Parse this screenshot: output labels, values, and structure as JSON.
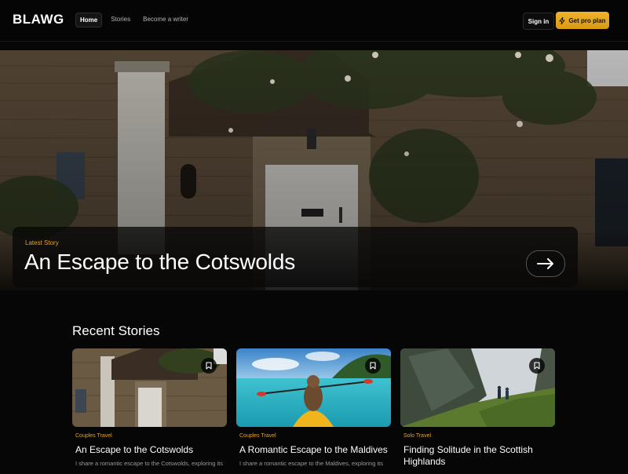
{
  "brand": {
    "logo": "BLAWG",
    "accent": "#f0b32a"
  },
  "nav": {
    "links": [
      "Home",
      "Stories",
      "Become a writer"
    ],
    "active": "Home",
    "signin": "Sign in",
    "pro": "Get pro plan",
    "pro_icon": "lightning-icon"
  },
  "hero": {
    "tag": "Latest Story",
    "title": "An Escape to the Cotswolds",
    "button_icon": "arrow-right-icon"
  },
  "recent": {
    "title": "Recent Stories",
    "cards": [
      {
        "category": "Couples Travel",
        "title": "An Escape to the Cotswolds",
        "excerpt": "I share a romantic escape to the Cotswolds, exploring its",
        "image": "stone-cottage-photo"
      },
      {
        "category": "Couples Travel",
        "title": "A Romantic Escape to the Maldives",
        "excerpt": "I share a romantic escape to the Maldives, exploring its",
        "image": "kayak-lagoon-photo"
      },
      {
        "category": "Solo Travel",
        "title": "Finding Solitude in the Scottish Highlands",
        "excerpt": "",
        "image": "highland-cliffs-photo"
      }
    ]
  }
}
